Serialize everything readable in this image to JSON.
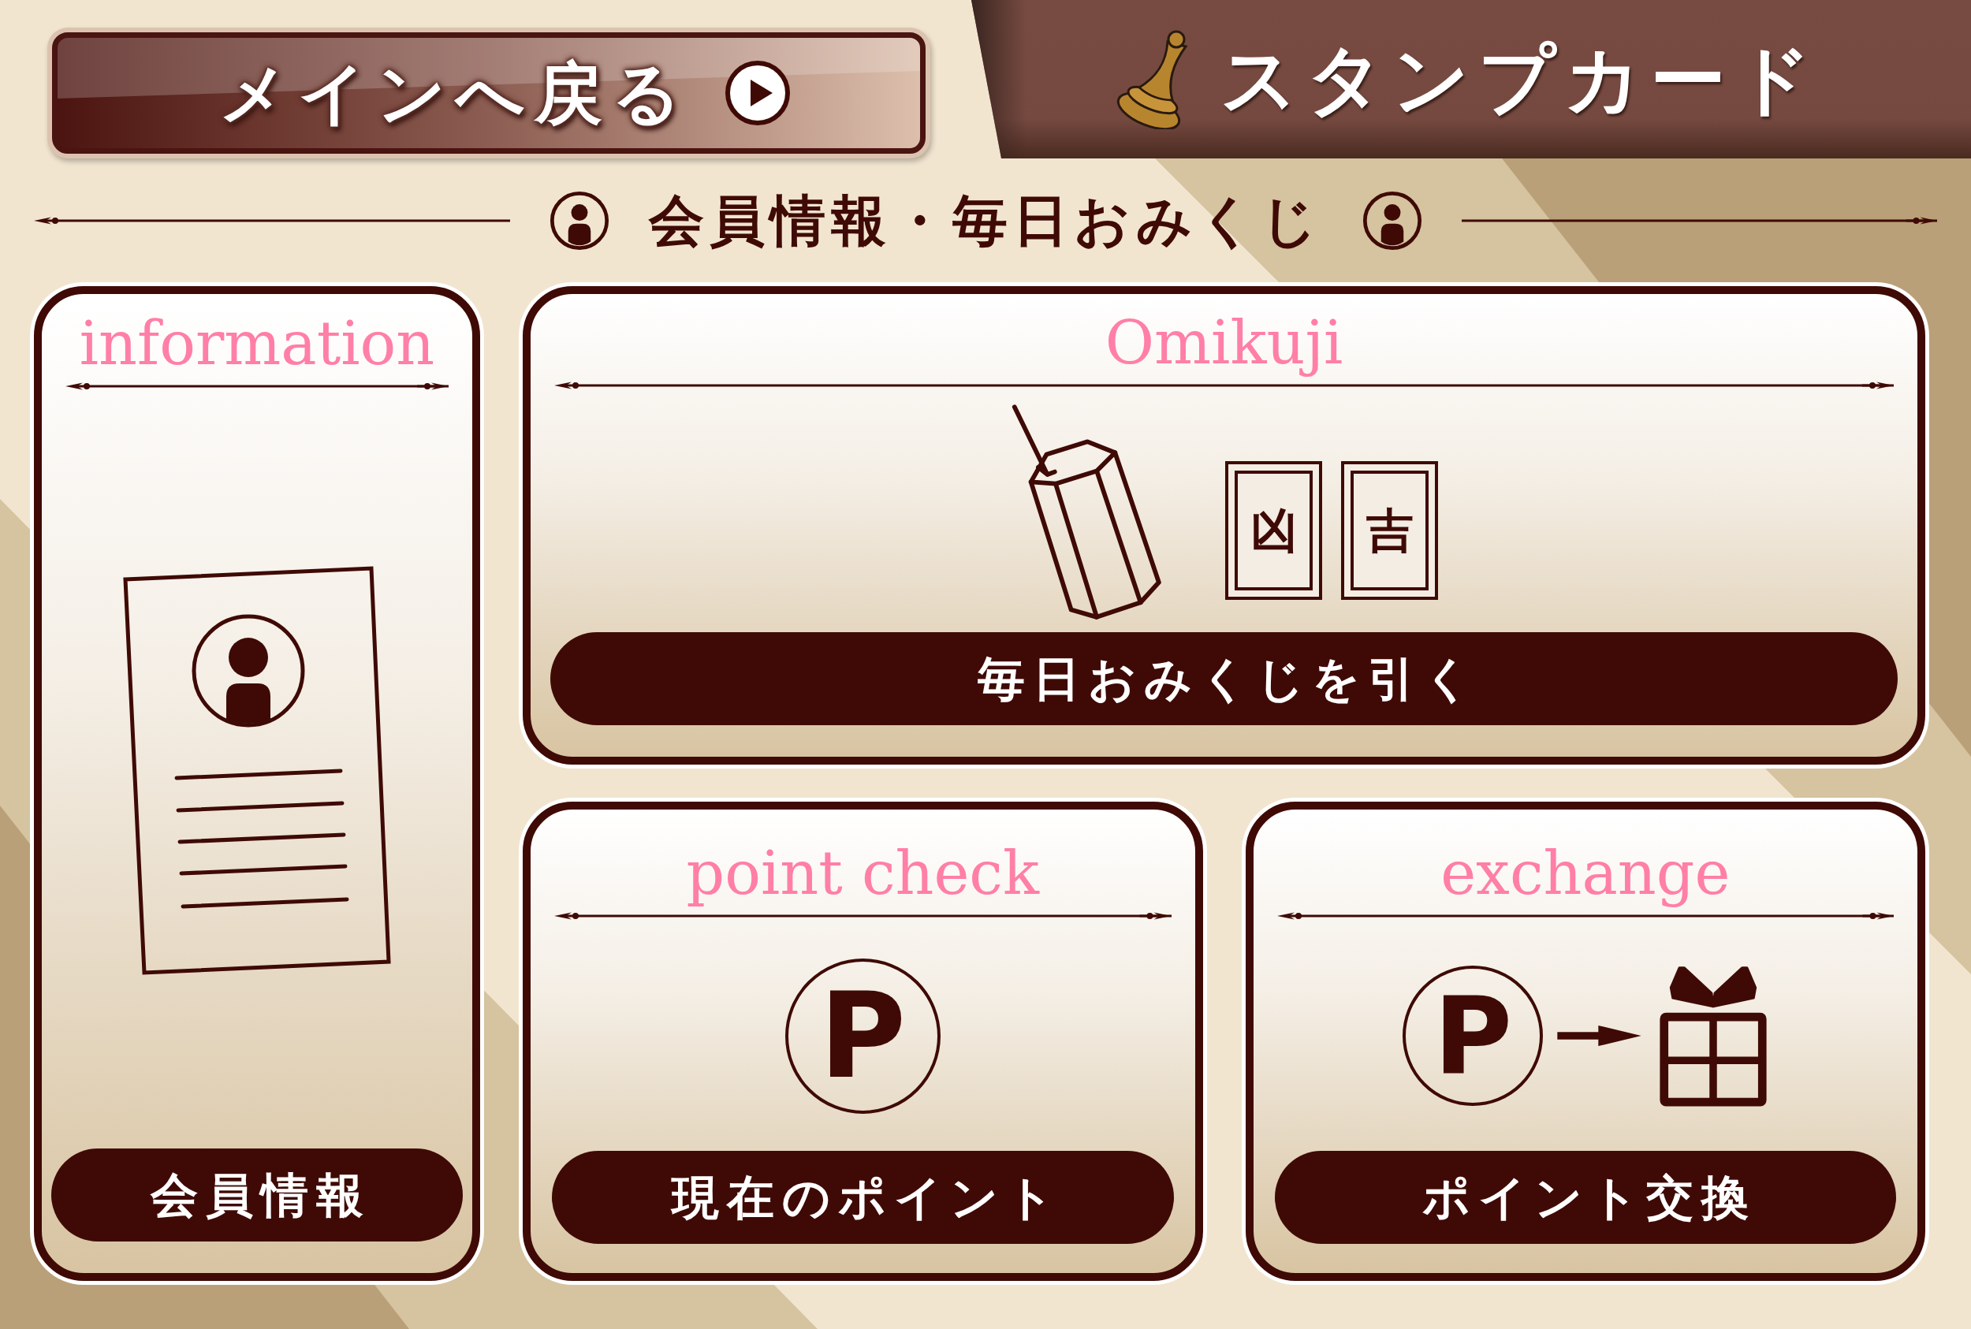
{
  "back_button": {
    "label": "メインへ戻る"
  },
  "title_banner": {
    "title": "スタンプカード"
  },
  "section_header": {
    "title": "会員情報・毎日おみくじ"
  },
  "cards": [
    {
      "kind": "information",
      "title": "information",
      "button": "会員情報"
    },
    {
      "kind": "omikuji",
      "title": "Omikuji",
      "slips": [
        "凶",
        "吉"
      ],
      "button": "毎日おみくじを引く"
    },
    {
      "kind": "point_check",
      "title": "point check",
      "symbol": "P",
      "button": "現在のポイント"
    },
    {
      "kind": "exchange",
      "title": "exchange",
      "symbol": "P",
      "button": "ポイント交換"
    }
  ]
}
